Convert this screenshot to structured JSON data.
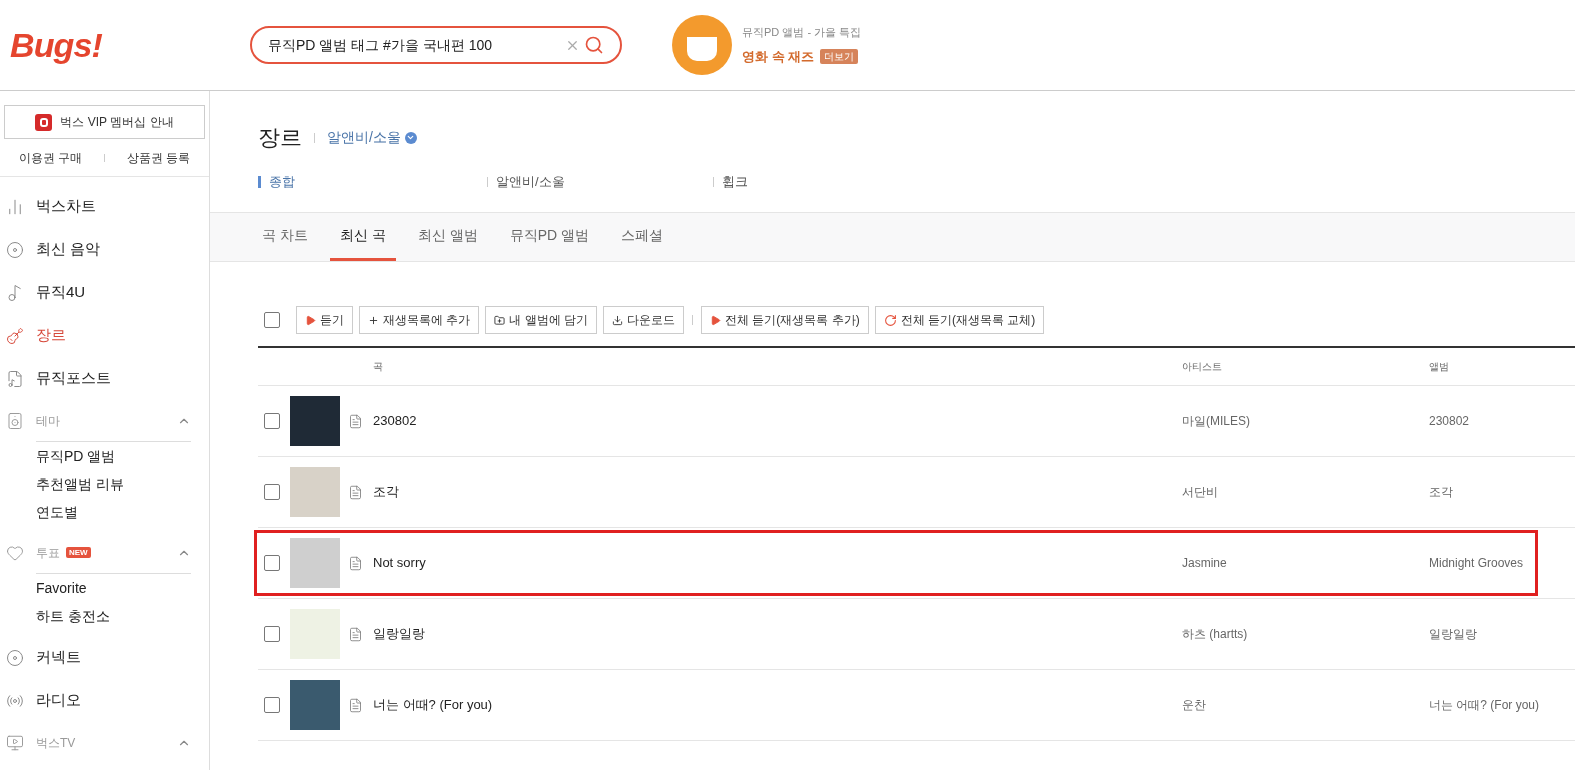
{
  "header": {
    "logo": "Bugs!",
    "search": {
      "value": "뮤직PD 앨범 태그 #가을 국내편 100"
    },
    "promo": {
      "caption": "뮤직PD 앨범 - 가을 특집",
      "title": "영화 속 재즈",
      "more": "더보기"
    }
  },
  "sidebar": {
    "vip_button": "벅스 VIP 멤버십 안내",
    "links": [
      "이용권 구매",
      "상품권 등록"
    ],
    "items": [
      {
        "kind": "link",
        "label": "벅스차트",
        "selected": false
      },
      {
        "kind": "link",
        "label": "최신 음악",
        "selected": false
      },
      {
        "kind": "link",
        "label": "뮤직4U",
        "selected": false
      },
      {
        "kind": "link",
        "label": "장르",
        "selected": true
      },
      {
        "kind": "link",
        "label": "뮤직포스트",
        "selected": false
      },
      {
        "kind": "group",
        "label": "테마",
        "expanded": true,
        "children": [
          "뮤직PD 앨범",
          "추천앨범 리뷰",
          "연도별"
        ]
      },
      {
        "kind": "group",
        "label": "투표",
        "badge": "NEW",
        "expanded": true,
        "children": [
          "Favorite",
          "하트 충전소"
        ]
      },
      {
        "kind": "link",
        "label": "커넥트",
        "selected": false
      },
      {
        "kind": "link",
        "label": "라디오",
        "selected": false
      },
      {
        "kind": "group",
        "label": "벅스TV",
        "expanded": true
      }
    ]
  },
  "page": {
    "title": "장르",
    "genre": "알앤비/소울",
    "subnav": [
      {
        "label": "종합",
        "selected": true
      },
      {
        "label": "알앤비/소울",
        "selected": false
      },
      {
        "label": "휩크",
        "selected": false
      }
    ],
    "tabs": [
      {
        "label": "곡 차트",
        "selected": false
      },
      {
        "label": "최신 곡",
        "selected": true
      },
      {
        "label": "최신 앨범",
        "selected": false
      },
      {
        "label": "뮤직PD 앨범",
        "selected": false
      },
      {
        "label": "스페셜",
        "selected": false
      }
    ],
    "toolbar": {
      "select_all": {
        "checked": false
      },
      "buttons": [
        "듣기",
        "재생목록에 추가",
        "내 앨범에 담기",
        "다운로드"
      ],
      "play_buttons": [
        "전체 듣기(재생목록 추가)",
        "전체 듣기(재생목록 교체)"
      ]
    },
    "table": {
      "columns": [
        "곡",
        "아티스트",
        "앨범"
      ],
      "rows": [
        {
          "title": "230802",
          "artist": "마일(MILES)",
          "album": "230802",
          "checked": false,
          "highlighted": false
        },
        {
          "title": "조각",
          "artist": "서단비",
          "album": "조각",
          "checked": false,
          "highlighted": false
        },
        {
          "title": "Not sorry",
          "artist": "Jasmine",
          "album": "Midnight Grooves",
          "checked": false,
          "highlighted": true
        },
        {
          "title": "일랑일랑",
          "artist": "하츠 (hartts)",
          "album": "일랑일랑",
          "checked": false,
          "highlighted": false
        },
        {
          "title": "너는 어때? (For you)",
          "artist": "운찬",
          "album": "너는 어때? (For you)",
          "checked": false,
          "highlighted": false
        }
      ]
    }
  }
}
